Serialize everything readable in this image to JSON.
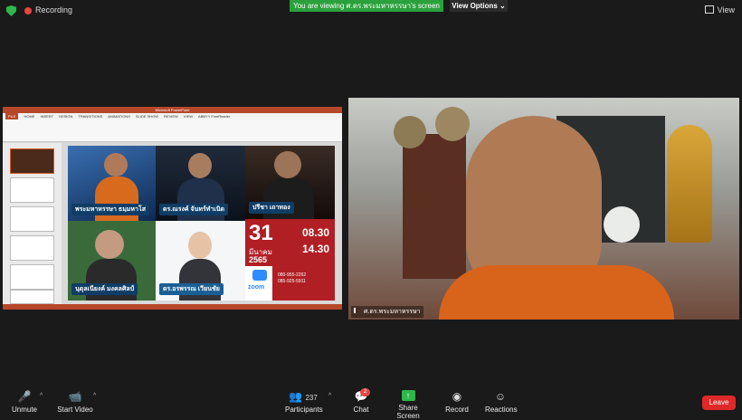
{
  "topbar": {
    "recording_label": "Recording",
    "banner_text": "You are viewing ศ.ดร.พระมหาหรรษา's screen",
    "view_options_label": "View Options",
    "view_label": "View"
  },
  "shared_screen": {
    "window_title": "Microsoft PowerPoint",
    "ribbon_tabs": [
      "FILE",
      "HOME",
      "INSERT",
      "DESIGN",
      "TRANSITIONS",
      "ANIMATIONS",
      "SLIDE SHOW",
      "REVIEW",
      "VIEW",
      "ABBYY FineReader"
    ],
    "speakers": [
      {
        "name": "พระมหาหรรษา ธมฺมหาโส"
      },
      {
        "name": "ดร.ณรงค์ จันทร์ทำเนิด"
      },
      {
        "name": "ปรีชา เถาทอง"
      },
      {
        "name": "นุดุลเนียงค์ มงคลศิลป์"
      },
      {
        "name": "ดร.อรพรรณ เวียนชัย"
      }
    ],
    "event": {
      "day": "31",
      "month": "มีนาคม",
      "year": "2565",
      "time_start": "08.30",
      "time_end": "14.30",
      "zoom_label": "zoom",
      "phone_1": "080-955-2262",
      "phone_2": "085-925-5911"
    }
  },
  "camera": {
    "participant_name": "ศ.ดร.พระมหาหรรษา"
  },
  "toolbar": {
    "unmute_label": "Unmute",
    "start_video_label": "Start Video",
    "participants_count": "237",
    "participants_label": "Participants",
    "chat_badge": "2",
    "chat_label": "Chat",
    "share_screen_label": "Share Screen",
    "record_label": "Record",
    "reactions_label": "Reactions",
    "leave_label": "Leave"
  },
  "colors": {
    "zoom_green": "#2eb84b",
    "leave_red": "#e02828",
    "ppt_orange": "#b7472a"
  }
}
